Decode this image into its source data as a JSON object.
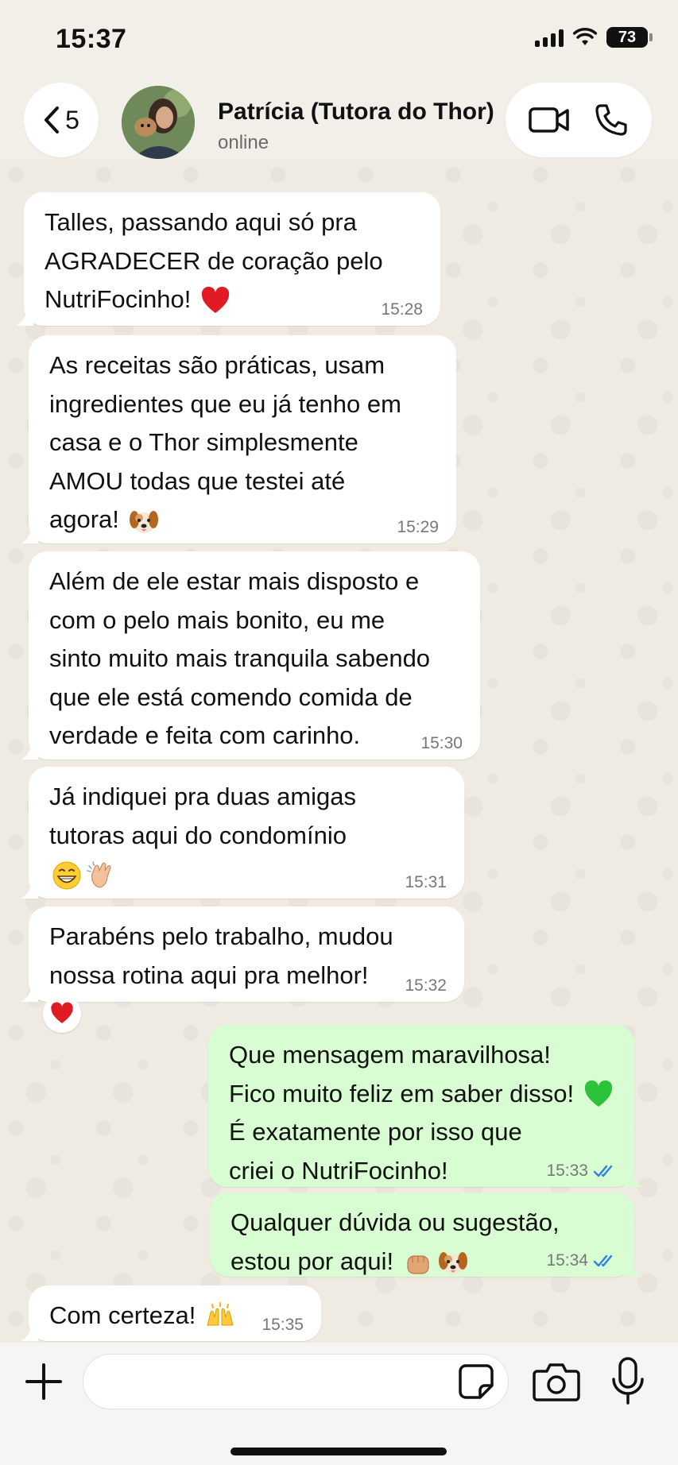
{
  "status_bar": {
    "time": "15:37",
    "battery": "73"
  },
  "header": {
    "back_count": "5",
    "contact_name": "Patrícia (Tutora do Thor)",
    "contact_status": "online"
  },
  "messages": [
    {
      "direction": "in",
      "lines": [
        "Talles, passando aqui só pra",
        "AGRADECER de coração pelo",
        "NutriFocinho!"
      ],
      "emoji": [
        "heart-red"
      ],
      "time": "15:28"
    },
    {
      "direction": "in",
      "lines": [
        "As receitas são práticas, usam",
        "ingredientes que eu já tenho em",
        "casa e o Thor simplesmente",
        "AMOU todas que testei até",
        "agora!"
      ],
      "emoji": [
        "dog-face"
      ],
      "time": "15:29"
    },
    {
      "direction": "in",
      "lines": [
        "Além de ele estar mais disposto e",
        "com o pelo mais bonito, eu me",
        "sinto muito mais tranquila sabendo",
        "que ele está comendo comida de",
        "verdade e feita com carinho."
      ],
      "emoji": [],
      "time": "15:30"
    },
    {
      "direction": "in",
      "lines": [
        "Já indiquei pra duas amigas",
        "tutoras aqui do condomínio"
      ],
      "emoji": [
        "grinning-face",
        "clapping-hands"
      ],
      "time": "15:31"
    },
    {
      "direction": "in",
      "lines": [
        "Parabéns pelo trabalho, mudou",
        "nossa rotina aqui pra melhor!"
      ],
      "emoji": [],
      "time": "15:32",
      "reaction": "heart-red"
    },
    {
      "direction": "out",
      "lines": [
        "Que mensagem maravilhosa!",
        "Fico muito feliz em saber disso!",
        "É exatamente por isso que",
        "criei o NutriFocinho!"
      ],
      "emoji": [
        "heart-green"
      ],
      "time": "15:33",
      "read": true
    },
    {
      "direction": "out",
      "lines": [
        "Qualquer dúvida ou sugestão,",
        "estou por aqui!"
      ],
      "emoji": [
        "fist-bump",
        "dog-face"
      ],
      "time": "15:34",
      "read": true
    },
    {
      "direction": "in",
      "lines": [
        "Com certeza!"
      ],
      "emoji": [
        "raising-hands"
      ],
      "time": "15:35"
    }
  ],
  "composer": {
    "placeholder": ""
  },
  "icons": [
    "back-chevron-icon",
    "video-call-icon",
    "phone-icon",
    "plus-icon",
    "sticker-icon",
    "camera-icon",
    "mic-icon",
    "read-receipt-icon"
  ],
  "colors": {
    "incoming_bubble": "#ffffff",
    "outgoing_bubble": "#d9fdd3",
    "read_tick": "#2f80ed",
    "wallpaper": "#efebe3"
  }
}
